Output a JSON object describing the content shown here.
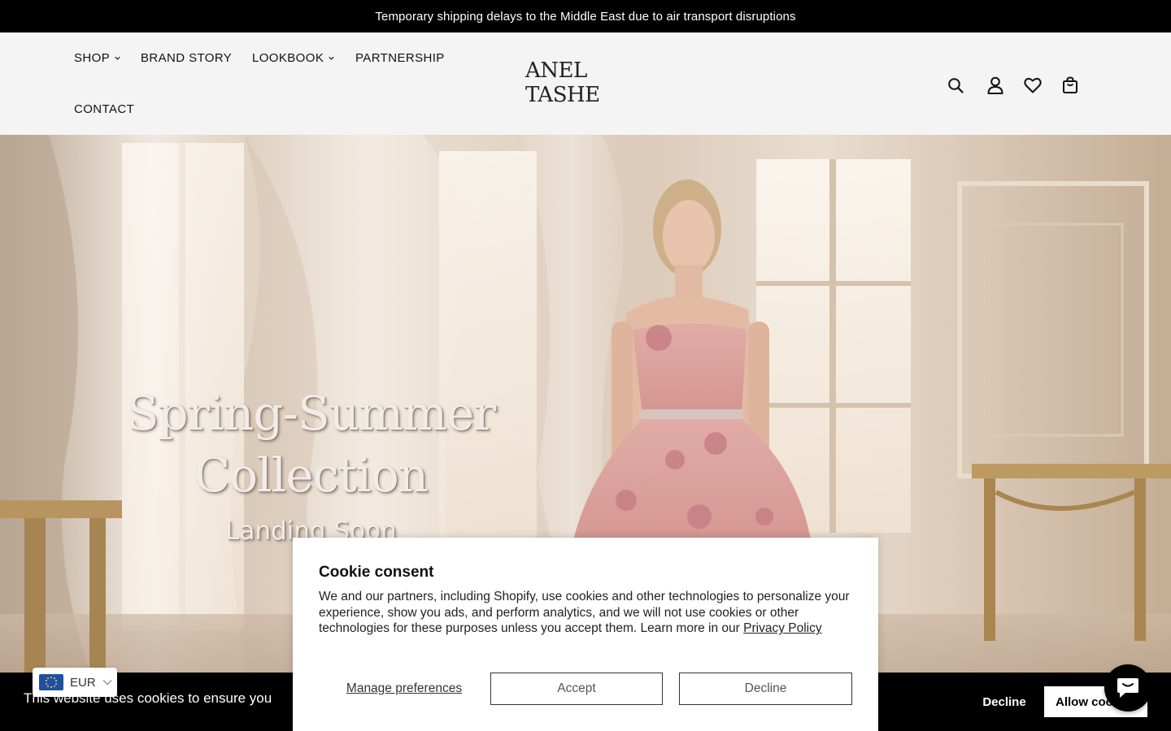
{
  "announcement": {
    "text": "Temporary shipping delays to the Middle East due to air transport disruptions"
  },
  "header": {
    "logo_text": "ANEL TASHE",
    "nav": [
      {
        "label": "SHOP",
        "has_dropdown": true
      },
      {
        "label": "BRAND STORY",
        "has_dropdown": false
      },
      {
        "label": "LOOKBOOK",
        "has_dropdown": true
      },
      {
        "label": "PARTNERSHIP",
        "has_dropdown": false
      },
      {
        "label": "CONTACT",
        "has_dropdown": false
      }
    ],
    "icons": [
      "search-icon",
      "account-icon",
      "wishlist-heart-icon",
      "cart-bag-icon"
    ]
  },
  "hero": {
    "title_line1": "Spring-Summer",
    "title_line2": "Collection",
    "subtitle": "Landing Soon"
  },
  "cookie_consent": {
    "title": "Cookie consent",
    "body": "We and our partners, including Shopify, use cookies and other technologies to personalize your experience, show you ads, and perform analytics, and we will not use cookies or other technologies for these purposes unless you accept them. Learn more in our ",
    "link": "Privacy Policy",
    "manage_label": "Manage preferences",
    "accept_label": "Accept",
    "decline_label": "Decline"
  },
  "cookie_bar": {
    "text": "This website uses cookies to ensure you",
    "decline_label": "Decline",
    "allow_label": "Allow cookies"
  },
  "currency": {
    "code": "EUR"
  },
  "colors": {
    "announcement_bg": "#000000",
    "header_bg": "#f4f4f4",
    "chat_bg": "#000000",
    "eu_flag": "#1f4fa0"
  }
}
